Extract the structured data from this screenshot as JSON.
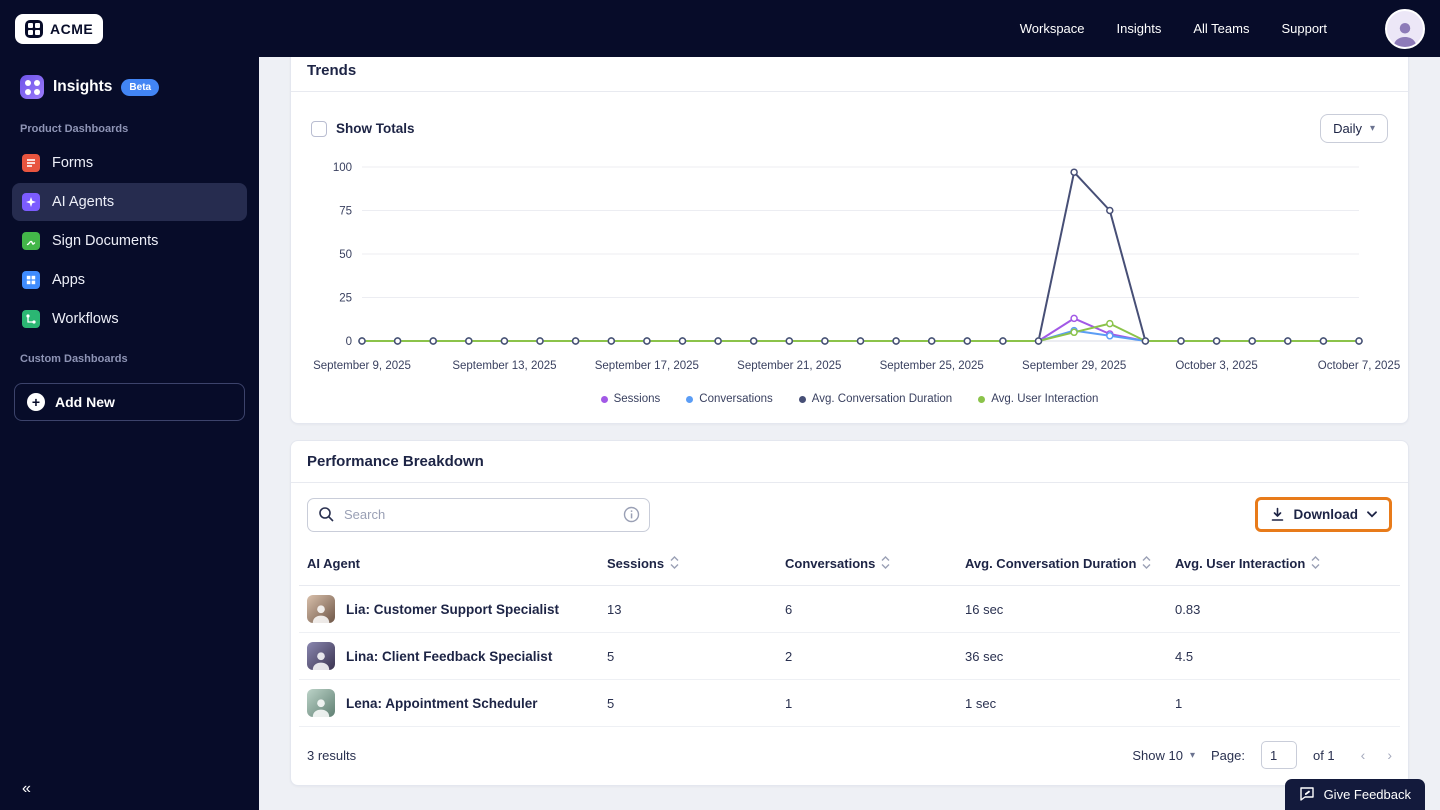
{
  "topbar": {
    "logo": "ACME",
    "nav": [
      {
        "label": "Workspace"
      },
      {
        "label": "Insights"
      },
      {
        "label": "All Teams"
      },
      {
        "label": "Support"
      }
    ]
  },
  "sidebar": {
    "title": "Insights",
    "badge": "Beta",
    "section1": "Product Dashboards",
    "section2": "Custom Dashboards",
    "items": [
      {
        "label": "Forms",
        "color": "#e8553f"
      },
      {
        "label": "AI Agents",
        "color": "#7c5cff"
      },
      {
        "label": "Sign Documents",
        "color": "#43b649"
      },
      {
        "label": "Apps",
        "color": "#3f8cff"
      },
      {
        "label": "Workflows",
        "color": "#2bb673"
      }
    ],
    "add_new": "Add New",
    "collapse": "«"
  },
  "trends": {
    "title": "Trends",
    "show_totals": "Show Totals",
    "interval": "Daily"
  },
  "chart_data": {
    "type": "line",
    "title": "Trends",
    "n_points": 29,
    "ylim": [
      0,
      100
    ],
    "yticks": [
      0,
      25,
      50,
      75,
      100
    ],
    "grid": true,
    "legend_position": "bottom",
    "x_tick_labels": [
      {
        "index": 0,
        "label": "September 9, 2025"
      },
      {
        "index": 4,
        "label": "September 13, 2025"
      },
      {
        "index": 8,
        "label": "September 17, 2025"
      },
      {
        "index": 12,
        "label": "September 21, 2025"
      },
      {
        "index": 16,
        "label": "September 25, 2025"
      },
      {
        "index": 20,
        "label": "September 29, 2025"
      },
      {
        "index": 24,
        "label": "October 3, 2025"
      },
      {
        "index": 28,
        "label": "October 7, 2025"
      }
    ],
    "series": [
      {
        "name": "Sessions",
        "color": "#a259e6",
        "values": [
          0,
          0,
          0,
          0,
          0,
          0,
          0,
          0,
          0,
          0,
          0,
          0,
          0,
          0,
          0,
          0,
          0,
          0,
          0,
          0,
          13,
          4,
          0,
          0,
          0,
          0,
          0,
          0,
          0
        ]
      },
      {
        "name": "Conversations",
        "color": "#5b9df5",
        "values": [
          0,
          0,
          0,
          0,
          0,
          0,
          0,
          0,
          0,
          0,
          0,
          0,
          0,
          0,
          0,
          0,
          0,
          0,
          0,
          0,
          6,
          3,
          0,
          0,
          0,
          0,
          0,
          0,
          0
        ]
      },
      {
        "name": "Avg. Conversation Duration",
        "color": "#474f76",
        "values": [
          0,
          0,
          0,
          0,
          0,
          0,
          0,
          0,
          0,
          0,
          0,
          0,
          0,
          0,
          0,
          0,
          0,
          0,
          0,
          0,
          97,
          75,
          0,
          0,
          0,
          0,
          0,
          0,
          0
        ]
      },
      {
        "name": "Avg. User Interaction",
        "color": "#8bc34a",
        "values": [
          0,
          0,
          0,
          0,
          0,
          0,
          0,
          0,
          0,
          0,
          0,
          0,
          0,
          0,
          0,
          0,
          0,
          0,
          0,
          0,
          5,
          10,
          0,
          0,
          0,
          0,
          0,
          0,
          0
        ]
      }
    ]
  },
  "performance": {
    "title": "Performance Breakdown",
    "search_placeholder": "Search",
    "download": "Download",
    "columns": [
      "AI Agent",
      "Sessions",
      "Conversations",
      "Avg. Conversation Duration",
      "Avg. User Interaction"
    ],
    "rows": [
      {
        "agent": "Lia: Customer Support Specialist",
        "sessions": "13",
        "conversations": "6",
        "avg_conversation_duration": "16 sec",
        "avg_user_interaction": "0.83"
      },
      {
        "agent": "Lina: Client Feedback Specialist",
        "sessions": "5",
        "conversations": "2",
        "avg_conversation_duration": "36 sec",
        "avg_user_interaction": "4.5"
      },
      {
        "agent": "Lena: Appointment Scheduler",
        "sessions": "5",
        "conversations": "1",
        "avg_conversation_duration": "1 sec",
        "avg_user_interaction": "1"
      }
    ],
    "footer": {
      "results": "3 results",
      "show_label": "Show 10",
      "page_label": "Page:",
      "page_value": "1",
      "of_label": "of 1"
    }
  },
  "feedback": "Give Feedback"
}
